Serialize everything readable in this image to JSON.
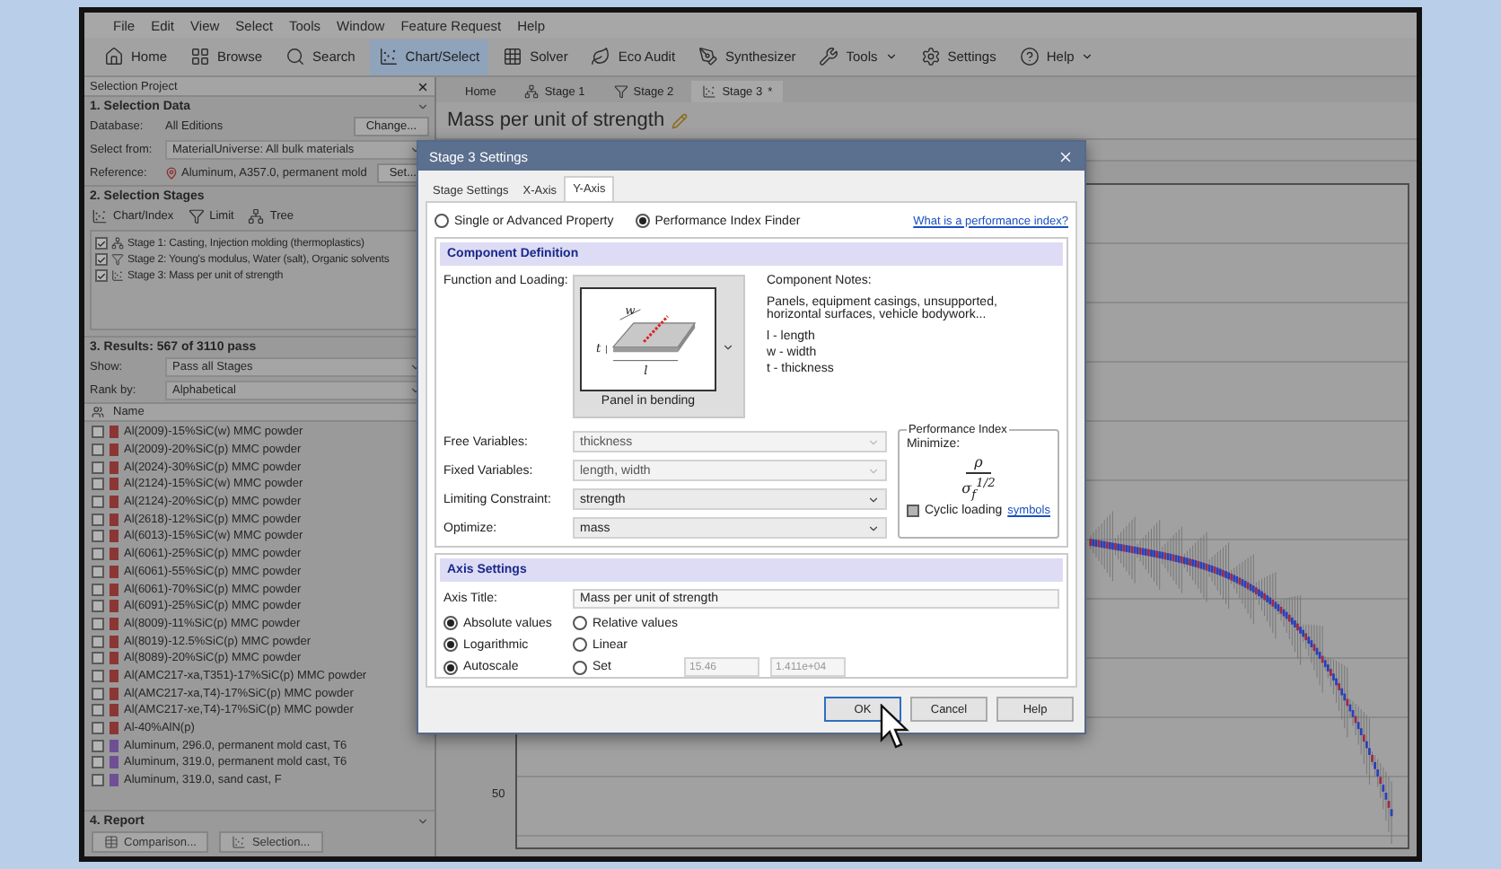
{
  "menu": [
    "File",
    "Edit",
    "View",
    "Select",
    "Tools",
    "Window",
    "Feature Request",
    "Help"
  ],
  "toolbar": [
    {
      "label": "Home",
      "kind": "home",
      "selected": false,
      "dropdown": false
    },
    {
      "label": "Browse",
      "kind": "browse",
      "selected": false,
      "dropdown": false
    },
    {
      "label": "Search",
      "kind": "search",
      "selected": false,
      "dropdown": false
    },
    {
      "label": "Chart/Select",
      "kind": "chart",
      "selected": true,
      "dropdown": false
    },
    {
      "label": "Solver",
      "kind": "solver",
      "selected": false,
      "dropdown": false
    },
    {
      "label": "Eco Audit",
      "kind": "eco",
      "selected": false,
      "dropdown": false
    },
    {
      "label": "Synthesizer",
      "kind": "synth",
      "selected": false,
      "dropdown": false
    },
    {
      "label": "Tools",
      "kind": "tools",
      "selected": false,
      "dropdown": true
    },
    {
      "label": "Settings",
      "kind": "settings",
      "selected": false,
      "dropdown": false
    },
    {
      "label": "Help",
      "kind": "help",
      "selected": false,
      "dropdown": true
    }
  ],
  "left_panel": {
    "title": "Selection Project",
    "selection_data": {
      "heading": "1. Selection Data",
      "database_label": "Database:",
      "database": "All Editions",
      "change_button": "Change...",
      "select_from_label": "Select from:",
      "select_from": "MaterialUniverse: All bulk materials",
      "reference_label": "Reference:",
      "reference": "Aluminum, A357.0, permanent mold",
      "set_button": "Set..."
    },
    "stages": {
      "heading": "2. Selection Stages",
      "tools": [
        {
          "label": "Chart/Index",
          "kind": "chart"
        },
        {
          "label": "Limit",
          "kind": "limit"
        },
        {
          "label": "Tree",
          "kind": "tree"
        }
      ],
      "items": [
        {
          "label": "Stage 1: Casting, Injection molding (thermoplastics)",
          "kind": "tree",
          "checked": true
        },
        {
          "label": "Stage 2: Young's modulus, Water (salt), Organic solvents",
          "kind": "limit",
          "checked": true
        },
        {
          "label": "Stage 3: Mass per unit of strength",
          "kind": "chart",
          "checked": true
        }
      ]
    },
    "results": {
      "heading": "3. Results: 567 of 3110 pass",
      "show_label": "Show:",
      "show": "Pass all Stages",
      "rank_label": "Rank by:",
      "rank": "Alphabetical",
      "column": "Name",
      "items": [
        {
          "name": "Al(2009)-15%SiC(w) MMC powder",
          "color": "#8c3535",
          "checked": false
        },
        {
          "name": "Al(2009)-20%SiC(p) MMC powder",
          "color": "#8c3535",
          "checked": false
        },
        {
          "name": "Al(2024)-30%SiC(p) MMC powder",
          "color": "#8c3535",
          "checked": false
        },
        {
          "name": "Al(2124)-15%SiC(w) MMC powder",
          "color": "#8c3535",
          "checked": false
        },
        {
          "name": "Al(2124)-20%SiC(p) MMC powder",
          "color": "#8c3535",
          "checked": false
        },
        {
          "name": "Al(2618)-12%SiC(p) MMC powder",
          "color": "#8c3535",
          "checked": false
        },
        {
          "name": "Al(6013)-15%SiC(w) MMC powder",
          "color": "#8c3535",
          "checked": false
        },
        {
          "name": "Al(6061)-25%SiC(p) MMC powder",
          "color": "#8c3535",
          "checked": false
        },
        {
          "name": "Al(6061)-55%SiC(p) MMC powder",
          "color": "#8c3535",
          "checked": false
        },
        {
          "name": "Al(6061)-70%SiC(p) MMC powder",
          "color": "#8c3535",
          "checked": false
        },
        {
          "name": "Al(6091)-25%SiC(p) MMC powder",
          "color": "#8c3535",
          "checked": false
        },
        {
          "name": "Al(8009)-11%SiC(p) MMC powder",
          "color": "#8c3535",
          "checked": false
        },
        {
          "name": "Al(8019)-12.5%SiC(p) MMC powder",
          "color": "#8c3535",
          "checked": false
        },
        {
          "name": "Al(8089)-20%SiC(p) MMC powder",
          "color": "#8c3535",
          "checked": false
        },
        {
          "name": "Al(AMC217-xa,T351)-17%SiC(p) MMC powder",
          "color": "#8c3535",
          "checked": false
        },
        {
          "name": "Al(AMC217-xa,T4)-17%SiC(p) MMC powder",
          "color": "#8c3535",
          "checked": false
        },
        {
          "name": "Al(AMC217-xe,T4)-17%SiC(p) MMC powder",
          "color": "#8c3535",
          "checked": false
        },
        {
          "name": "Al-40%AlN(p)",
          "color": "#8c3535",
          "checked": false
        },
        {
          "name": "Aluminum, 296.0, permanent mold cast, T6",
          "color": "#6e4f96",
          "checked": false
        },
        {
          "name": "Aluminum, 319.0, permanent mold cast, T6",
          "color": "#6e4f96",
          "checked": false
        },
        {
          "name": "Aluminum, 319.0, sand cast, F",
          "color": "#6e4f96",
          "checked": false
        }
      ]
    },
    "report": {
      "heading": "4. Report",
      "buttons": [
        {
          "label": "Comparison...",
          "kind": "compare"
        },
        {
          "label": "Selection...",
          "kind": "chart"
        }
      ]
    }
  },
  "document_tabs": [
    {
      "label": "Home",
      "kind": "plain",
      "selected": false
    },
    {
      "label": "Stage 1",
      "kind": "tree",
      "selected": false
    },
    {
      "label": "Stage 2",
      "kind": "limit",
      "selected": false
    },
    {
      "label": "Stage 3",
      "kind": "chart",
      "selected": true,
      "badge": "*"
    }
  ],
  "page_title": "Mass per unit of strength",
  "chart": {
    "tick_label": "50"
  },
  "dialog": {
    "title": "Stage 3 Settings",
    "tabs": [
      {
        "label": "Stage Settings",
        "selected": false
      },
      {
        "label": "X-Axis",
        "selected": false
      },
      {
        "label": "Y-Axis",
        "selected": true
      }
    ],
    "modes": [
      {
        "label": "Single or Advanced Property",
        "selected": false
      },
      {
        "label": "Performance Index Finder",
        "selected": true
      }
    ],
    "help_link": "What is a performance index?",
    "component": {
      "heading": "Component Definition",
      "function_label": "Function and Loading:",
      "loading": "Panel in bending",
      "diagram_labels": [
        "w",
        "t",
        "l"
      ],
      "notes_heading": "Component Notes:",
      "notes": "Panels, equipment casings, unsupported, horizontal surfaces, vehicle bodywork...",
      "legend": [
        "l - length",
        "w - width",
        "t - thickness"
      ],
      "fields": [
        {
          "label": "Free Variables:",
          "value": "thickness",
          "disabled": true
        },
        {
          "label": "Fixed Variables:",
          "value": "length, width",
          "disabled": true
        },
        {
          "label": "Limiting Constraint:",
          "value": "strength",
          "disabled": false
        },
        {
          "label": "Optimize:",
          "value": "mass",
          "disabled": false
        }
      ],
      "index": {
        "title": "Performance Index",
        "label": "Minimize:",
        "numerator": "ρ",
        "denominator": "σ$_{f}$$^{1/2}$",
        "cyclic_label": "Cyclic loading",
        "cyclic_checked": false,
        "symbols_link": "symbols"
      }
    },
    "axis": {
      "heading": "Axis Settings",
      "title_label": "Axis Title:",
      "title": "Mass per unit of strength",
      "options": [
        {
          "choices": [
            {
              "label": "Absolute values",
              "selected": true
            },
            {
              "label": "Relative values",
              "selected": false
            }
          ]
        },
        {
          "choices": [
            {
              "label": "Logarithmic",
              "selected": true
            },
            {
              "label": "Linear",
              "selected": false
            }
          ]
        },
        {
          "choices": [
            {
              "label": "Autoscale",
              "selected": true
            },
            {
              "label": "Set",
              "selected": false
            }
          ],
          "range": [
            "15.46",
            "1.411e+04"
          ]
        }
      ]
    },
    "buttons": [
      {
        "label": "OK",
        "default": true
      },
      {
        "label": "Cancel",
        "default": false
      },
      {
        "label": "Help",
        "default": false
      }
    ]
  }
}
